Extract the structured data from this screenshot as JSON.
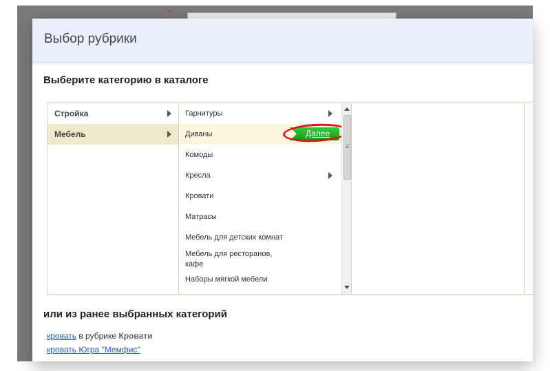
{
  "background": {
    "required_mark": "*"
  },
  "modal": {
    "title": "Выбор рубрики",
    "catalog_heading": "Выберите категорию в каталоге",
    "recent_heading": "или из ранее выбранных категорий"
  },
  "level1": [
    {
      "label": "Стройка",
      "selected": false
    },
    {
      "label": "Мебель",
      "selected": true
    }
  ],
  "level2": [
    {
      "label": "Гарнитуры",
      "has_children": true
    },
    {
      "label": "Диваны",
      "selected": true
    },
    {
      "label": "Комоды"
    },
    {
      "label": "Кресла",
      "has_children": true
    },
    {
      "label": "Кровати"
    },
    {
      "label": "Матрасы"
    },
    {
      "label": "Мебель для детских комнат"
    },
    {
      "label": "Мебель для ресторанов, кафе"
    },
    {
      "label": "Наборы мягкой мебели"
    }
  ],
  "next_button": {
    "label": "Далее"
  },
  "recent": [
    {
      "link": "кровать",
      "in_rubric_text": "в рубрике",
      "rubric": "Кровати"
    },
    {
      "link": "кровать Югра \"Мемфис\""
    }
  ],
  "colors": {
    "header_bg": "#e9f0fa",
    "selected_level1": "#eeeacd",
    "selected_level2": "#fbf7de",
    "next_button": "#1aa51d",
    "highlight_ring": "#d11a1a",
    "link": "#2a5db0"
  }
}
